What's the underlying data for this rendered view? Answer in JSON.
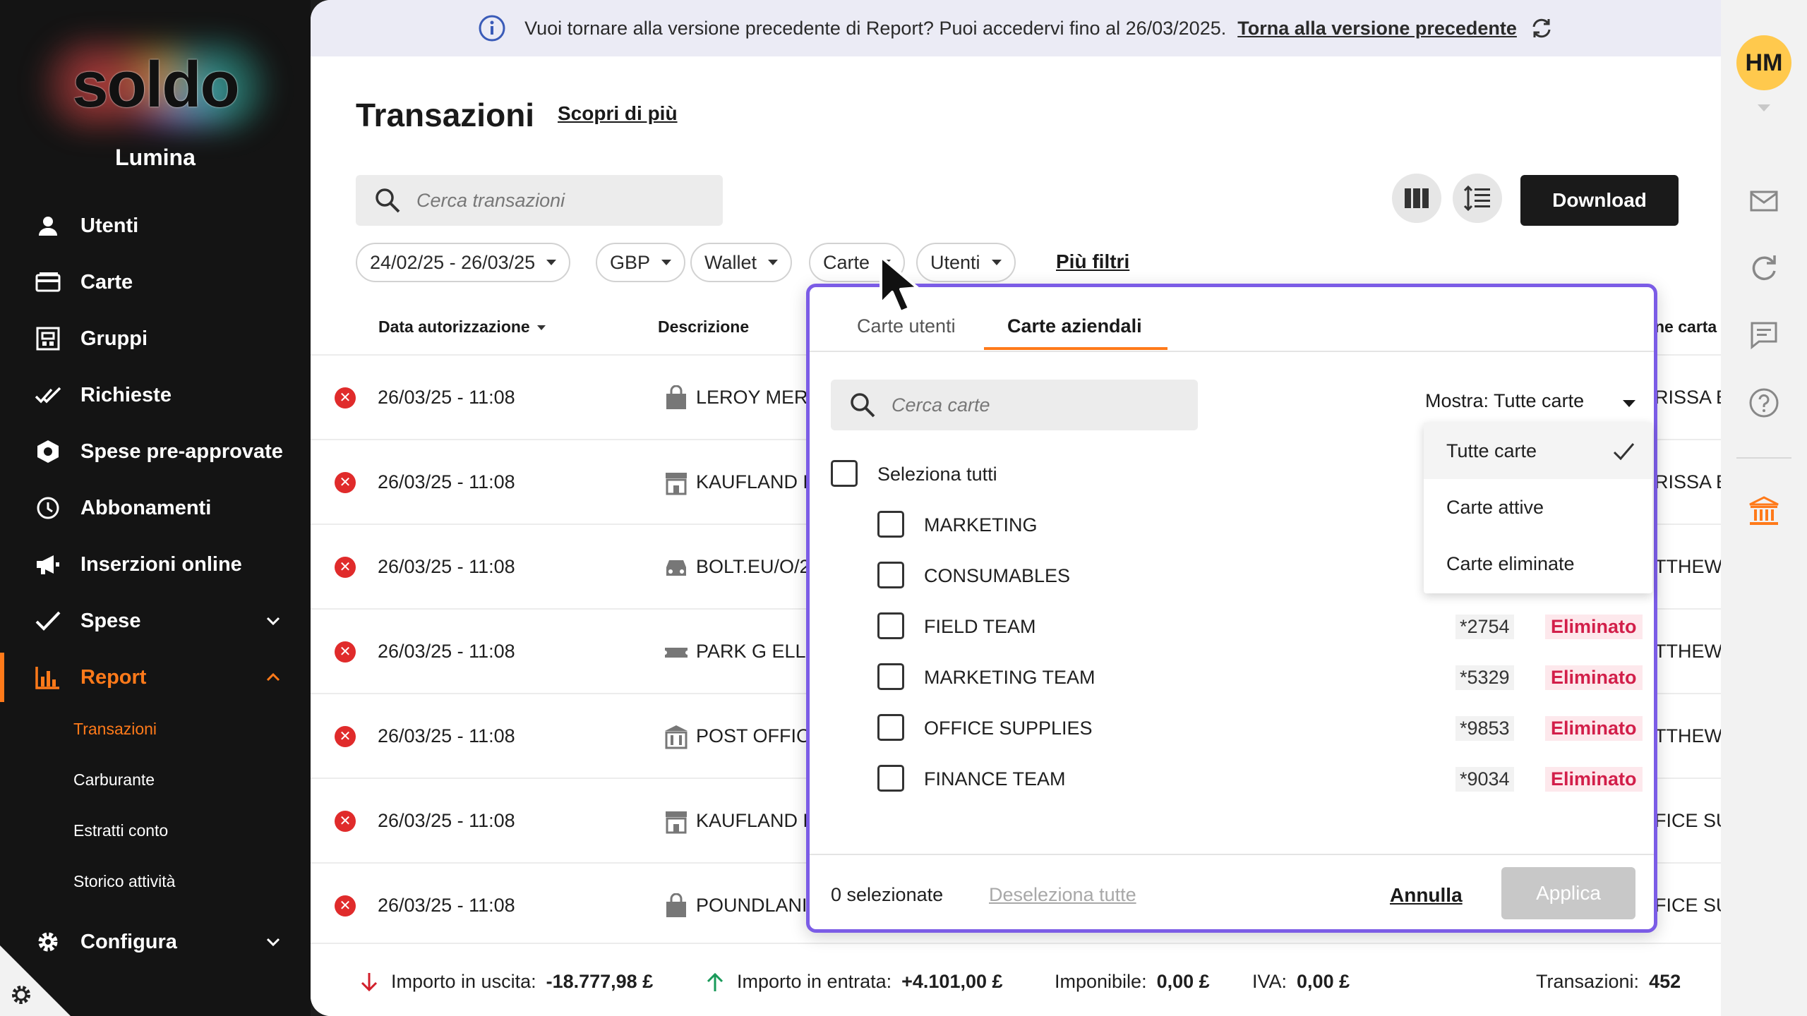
{
  "sidebar": {
    "logo_text": "soldo",
    "org_name": "Lumina",
    "items": [
      {
        "label": "Utenti",
        "icon": "user-icon"
      },
      {
        "label": "Carte",
        "icon": "card-icon"
      },
      {
        "label": "Gruppi",
        "icon": "group-icon"
      },
      {
        "label": "Richieste",
        "icon": "double-check-icon"
      },
      {
        "label": "Spese pre-approvate",
        "icon": "hexagon-icon"
      },
      {
        "label": "Abbonamenti",
        "icon": "clock-icon"
      },
      {
        "label": "Inserzioni online",
        "icon": "megaphone-icon"
      },
      {
        "label": "Spese",
        "icon": "check-icon"
      },
      {
        "label": "Report",
        "icon": "bar-chart-icon"
      },
      {
        "label": "Configura",
        "icon": "gear-icon"
      }
    ],
    "report_sub": [
      "Transazioni",
      "Carburante",
      "Estratti conto",
      "Storico attività"
    ]
  },
  "banner": {
    "text": "Vuoi tornare alla versione precedente di Report? Puoi accedervi fino al 26/03/2025.",
    "link": "Torna alla versione precedente"
  },
  "header": {
    "title": "Transazioni",
    "learn_more": "Scopri di più",
    "search_placeholder": "Cerca transazioni",
    "download": "Download"
  },
  "filters": {
    "date": "24/02/25 - 26/03/25",
    "currency": "GBP",
    "wallet": "Wallet",
    "cards": "Carte",
    "users": "Utenti",
    "more": "Più filtri"
  },
  "columns": {
    "date": "Data autorizzazione",
    "description": "Descrizione",
    "owner": "ne carta"
  },
  "rows": [
    {
      "date": "26/03/25 - 11:08",
      "merchant": "LEROY MERL",
      "owner": "RISSA EI"
    },
    {
      "date": "26/03/25 - 11:08",
      "merchant": "KAUFLAND F",
      "owner": "RISSA EI"
    },
    {
      "date": "26/03/25 - 11:08",
      "merchant": "BOLT.EU/O/2",
      "owner": "TTHEW"
    },
    {
      "date": "26/03/25 - 11:08",
      "merchant": "PARK G ELL E",
      "owner": "TTHEW"
    },
    {
      "date": "26/03/25 - 11:08",
      "merchant": "POST OFFICE",
      "owner": "TTHEW"
    },
    {
      "date": "26/03/25 - 11:08",
      "merchant": "KAUFLAND F",
      "owner": "FICE SUI"
    },
    {
      "date": "26/03/25 - 11:08",
      "merchant": "POUNDLANI",
      "owner": "FICE SUI"
    }
  ],
  "footer": {
    "out_label": "Importo in uscita:",
    "out_value": "-18.777,98 £",
    "in_label": "Importo in entrata:",
    "in_value": "+4.101,00 £",
    "taxable_label": "Imponibile:",
    "taxable_value": "0,00 £",
    "vat_label": "IVA:",
    "vat_value": "0,00 £",
    "count_label": "Transazioni:",
    "count_value": "452"
  },
  "user": {
    "initials": "HM"
  },
  "popover": {
    "tab_users": "Carte utenti",
    "tab_company": "Carte aziendali",
    "search_placeholder": "Cerca carte",
    "show_label": "Mostra: Tutte carte",
    "menu": [
      "Tutte carte",
      "Carte attive",
      "Carte eliminate"
    ],
    "select_all": "Seleziona tutti",
    "cards": [
      {
        "name": "MARKETING",
        "number": "",
        "status": ""
      },
      {
        "name": "CONSUMABLES",
        "number": "",
        "status": ""
      },
      {
        "name": "FIELD TEAM",
        "number": "*2754",
        "status": "Eliminato"
      },
      {
        "name": "MARKETING TEAM",
        "number": "*5329",
        "status": "Eliminato"
      },
      {
        "name": "OFFICE SUPPLIES",
        "number": "*9853",
        "status": "Eliminato"
      },
      {
        "name": "FINANCE TEAM",
        "number": "*9034",
        "status": "Eliminato"
      }
    ],
    "selected_count": "0 selezionate",
    "deselect_all": "Deseleziona tutte",
    "cancel": "Annulla",
    "apply": "Applica"
  },
  "colors": {
    "accent": "#ff7a1a",
    "popover_border": "#7b5ce6",
    "error": "#e02b2b",
    "deleted": "#d21f4a"
  }
}
